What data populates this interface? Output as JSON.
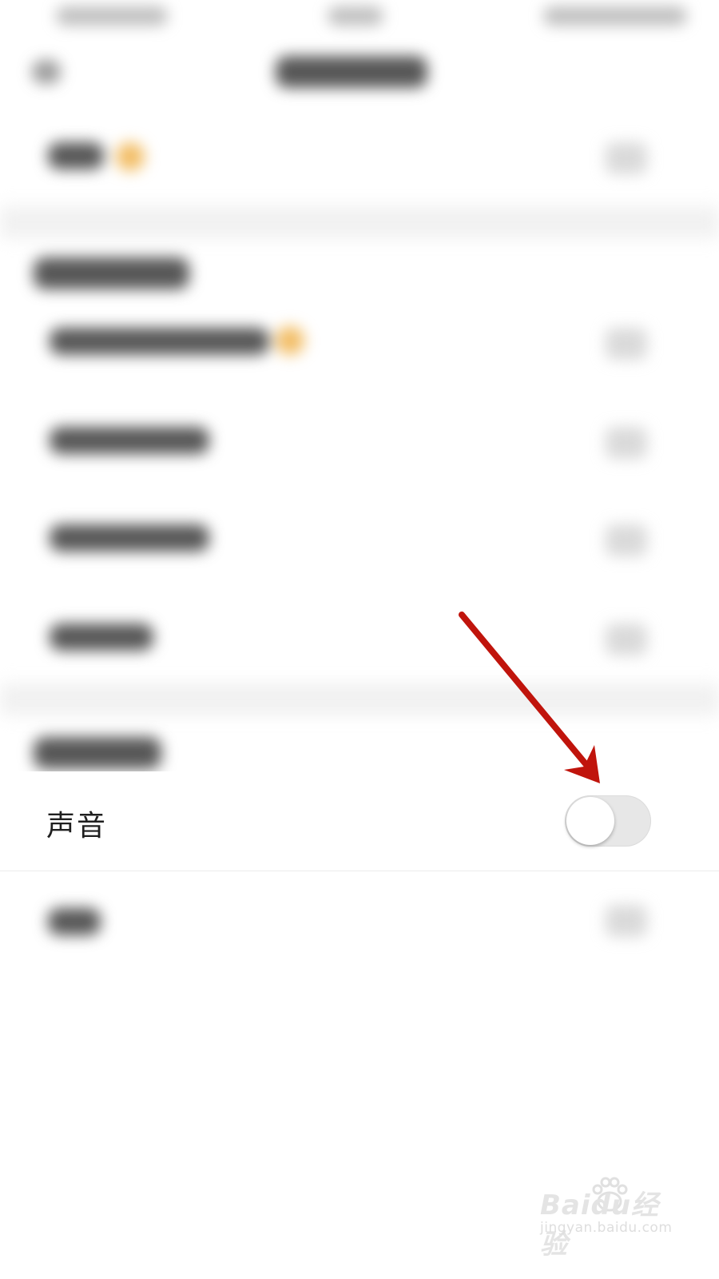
{
  "settings": {
    "sound_label": "声音",
    "sound_toggle_on": false
  },
  "colors": {
    "background": "#ffffff",
    "section_gap": "#f1f1f1",
    "toggle_track_off": "#e7e7e7",
    "toggle_knob": "#ffffff",
    "annotation_arrow": "#c0140c",
    "accent_orange": "#f0b24a"
  },
  "annotation": {
    "arrow_icon": "red-arrow-pointing-at-toggle"
  },
  "watermark": {
    "brand_text": "Baidu经验",
    "url_text": "jingyan.baidu.com"
  }
}
